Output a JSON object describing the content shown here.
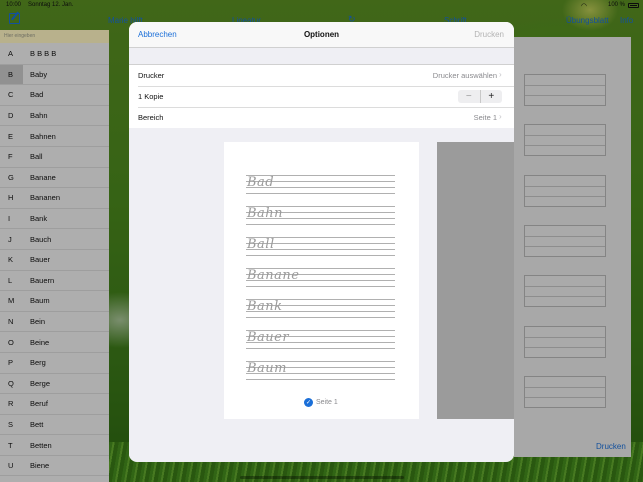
{
  "statusbar": {
    "time": "10:00",
    "date": "Sonntag 12. Jan.",
    "battery": "100 %"
  },
  "topnav": {
    "name": "Marie hilft",
    "lineatur": "Lineatur",
    "schrift": "Schrift",
    "uebungsblatt": "Übungsblatt",
    "info": "Info"
  },
  "search": {
    "placeholder": "Hier eingeben"
  },
  "wordlist": [
    {
      "letter": "A",
      "word": "B B B B"
    },
    {
      "letter": "B",
      "word": "Baby",
      "selected": true
    },
    {
      "letter": "C",
      "word": "Bad"
    },
    {
      "letter": "D",
      "word": "Bahn"
    },
    {
      "letter": "E",
      "word": "Bahnen"
    },
    {
      "letter": "F",
      "word": "Ball"
    },
    {
      "letter": "G",
      "word": "Banane"
    },
    {
      "letter": "H",
      "word": "Bananen"
    },
    {
      "letter": "I",
      "word": "Bank"
    },
    {
      "letter": "J",
      "word": "Bauch"
    },
    {
      "letter": "K",
      "word": "Bauer"
    },
    {
      "letter": "L",
      "word": "Bauern"
    },
    {
      "letter": "M",
      "word": "Baum"
    },
    {
      "letter": "N",
      "word": "Bein"
    },
    {
      "letter": "O",
      "word": "Beine"
    },
    {
      "letter": "P",
      "word": "Berg"
    },
    {
      "letter": "Q",
      "word": "Berge"
    },
    {
      "letter": "R",
      "word": "Beruf"
    },
    {
      "letter": "S",
      "word": "Bett"
    },
    {
      "letter": "T",
      "word": "Betten"
    },
    {
      "letter": "U",
      "word": "Biene"
    }
  ],
  "modal": {
    "cancel": "Abbrechen",
    "title": "Optionen",
    "print": "Drucken",
    "printer_label": "Drucker",
    "printer_value": "Drucker auswählen",
    "copies_label": "1 Kopie",
    "stepper_minus": "−",
    "stepper_plus": "+",
    "range_label": "Bereich",
    "range_value": "Seite 1",
    "preview_words": [
      "Bad",
      "Bahn",
      "Ball",
      "Banane",
      "Bank",
      "Bauer",
      "Baum"
    ],
    "page_label": "Seite 1"
  },
  "sheet": {
    "print": "Drucken"
  },
  "colors": {
    "accent": "#1b6fd8",
    "search_bg": "#fff5c2"
  }
}
